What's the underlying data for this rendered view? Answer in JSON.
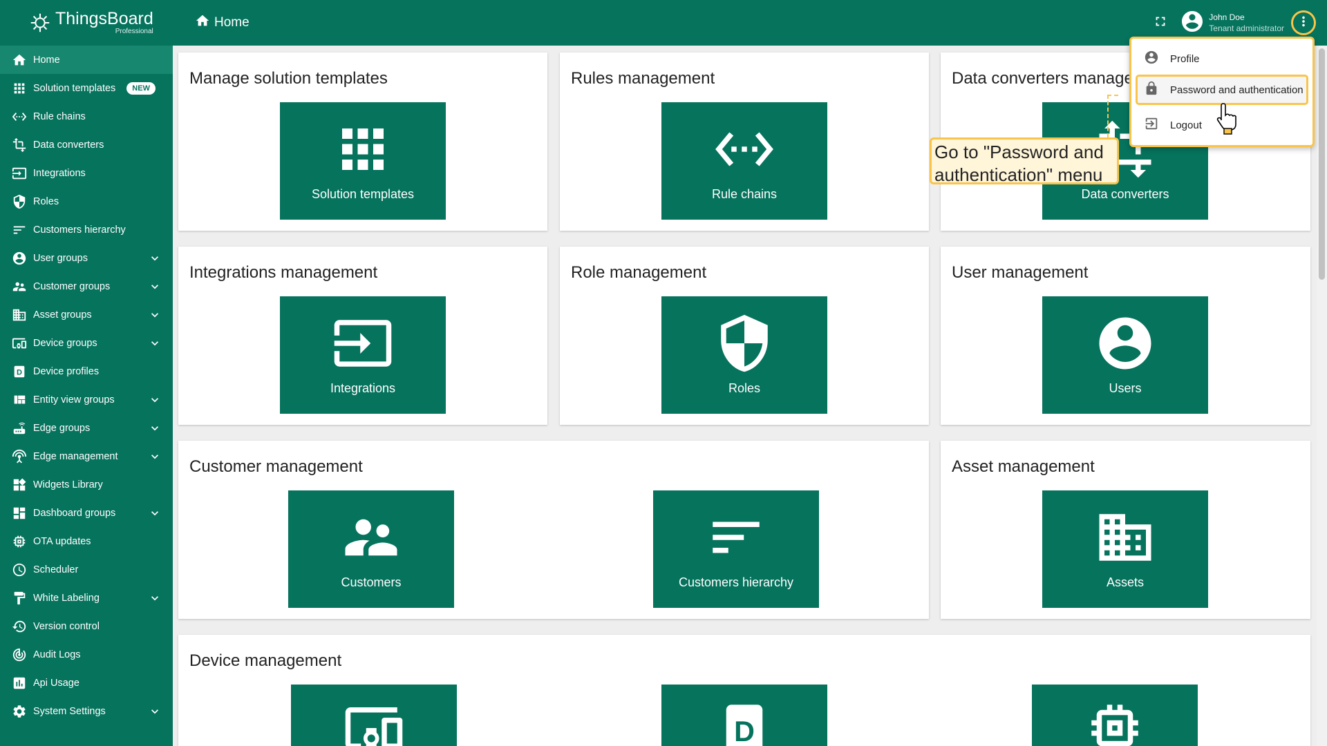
{
  "app": {
    "name": "ThingsBoard",
    "edition": "Professional"
  },
  "sidebar": {
    "items": [
      {
        "label": "Home",
        "icon": "home-icon",
        "active": true,
        "expandable": false
      },
      {
        "label": "Solution templates",
        "icon": "apps-icon",
        "badge": "NEW",
        "expandable": false
      },
      {
        "label": "Rule chains",
        "icon": "settings-ethernet-icon",
        "expandable": false
      },
      {
        "label": "Data converters",
        "icon": "transform-icon",
        "expandable": false
      },
      {
        "label": "Integrations",
        "icon": "input-icon",
        "expandable": false
      },
      {
        "label": "Roles",
        "icon": "shield-icon",
        "expandable": false
      },
      {
        "label": "Customers hierarchy",
        "icon": "sort-icon",
        "expandable": false
      },
      {
        "label": "User groups",
        "icon": "account-circle-icon",
        "expandable": true
      },
      {
        "label": "Customer groups",
        "icon": "supervisor-account-icon",
        "expandable": true
      },
      {
        "label": "Asset groups",
        "icon": "domain-icon",
        "expandable": true
      },
      {
        "label": "Device groups",
        "icon": "devices-other-icon",
        "expandable": true
      },
      {
        "label": "Device profiles",
        "icon": "device-profile-icon",
        "expandable": false
      },
      {
        "label": "Entity view groups",
        "icon": "view-quilt-icon",
        "expandable": true
      },
      {
        "label": "Edge groups",
        "icon": "router-icon",
        "expandable": true
      },
      {
        "label": "Edge management",
        "icon": "settings-input-antenna-icon",
        "expandable": true
      },
      {
        "label": "Widgets Library",
        "icon": "widgets-icon",
        "expandable": false
      },
      {
        "label": "Dashboard groups",
        "icon": "dashboard-icon",
        "expandable": true
      },
      {
        "label": "OTA updates",
        "icon": "memory-icon",
        "expandable": false
      },
      {
        "label": "Scheduler",
        "icon": "schedule-icon",
        "expandable": false
      },
      {
        "label": "White Labeling",
        "icon": "format-paint-icon",
        "expandable": true
      },
      {
        "label": "Version control",
        "icon": "history-icon",
        "expandable": false
      },
      {
        "label": "Audit Logs",
        "icon": "track-changes-icon",
        "expandable": false
      },
      {
        "label": "Api Usage",
        "icon": "insert-chart-icon",
        "expandable": false
      },
      {
        "label": "System Settings",
        "icon": "settings-icon",
        "expandable": true
      }
    ]
  },
  "header": {
    "breadcrumb": "Home",
    "user_name": "John Doe",
    "user_role": "Tenant administrator"
  },
  "cards": {
    "solution_templates": {
      "title": "Manage solution templates",
      "tile": "Solution templates"
    },
    "rules": {
      "title": "Rules management",
      "tile": "Rule chains"
    },
    "data_converters": {
      "title": "Data converters manage",
      "tile": "Data converters"
    },
    "integrations": {
      "title": "Integrations management",
      "tile": "Integrations"
    },
    "roles": {
      "title": "Role management",
      "tile": "Roles"
    },
    "users": {
      "title": "User management",
      "tile": "Users"
    },
    "customers": {
      "title": "Customer management",
      "tile1": "Customers",
      "tile2": "Customers hierarchy"
    },
    "assets": {
      "title": "Asset management",
      "tile": "Assets"
    },
    "devices": {
      "title": "Device management"
    }
  },
  "user_menu": {
    "items": [
      {
        "label": "Profile",
        "icon": "account-circle-icon"
      },
      {
        "label": "Password and authentication",
        "icon": "lock-icon"
      },
      {
        "label": "Logout",
        "icon": "exit-to-app-icon"
      }
    ]
  },
  "tooltip": {
    "line1": "Go to \"Password and",
    "line2": "authentication\" menu"
  },
  "colors": {
    "primary": "#06735d",
    "active": "#17876f",
    "highlight": "#f9c44b",
    "tooltip_bg": "#fff6d9"
  }
}
